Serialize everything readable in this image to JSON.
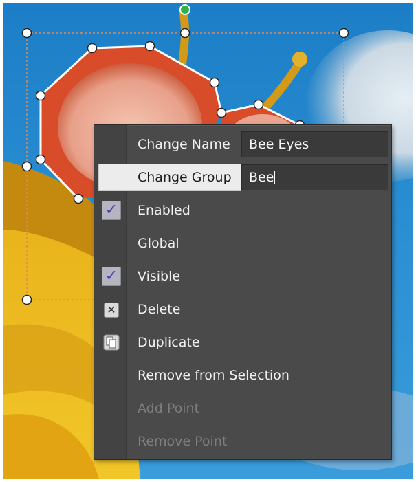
{
  "menu": {
    "change_name": {
      "label": "Change Name",
      "value": "Bee Eyes"
    },
    "change_group": {
      "label": "Change Group",
      "value": "Bee"
    },
    "items": [
      {
        "label": "Enabled",
        "checked": true,
        "icon": "check-icon"
      },
      {
        "label": "Global",
        "checked": false,
        "icon": ""
      },
      {
        "label": "Visible",
        "checked": true,
        "icon": "check-icon"
      },
      {
        "label": "Delete",
        "icon": "delete-icon"
      },
      {
        "label": "Duplicate",
        "icon": "duplicate-icon"
      },
      {
        "label": "Remove from Selection",
        "icon": ""
      },
      {
        "label": "Add Point",
        "disabled": true,
        "icon": ""
      },
      {
        "label": "Remove Point",
        "disabled": true,
        "icon": ""
      }
    ],
    "check_glyph": "✓",
    "delete_glyph": "✕"
  },
  "colors": {
    "menu_bg": "#4a4a4a",
    "shape_outline": "#ffffff",
    "selection_box": "#e2874f",
    "transform_handle": "#2bb34a"
  }
}
